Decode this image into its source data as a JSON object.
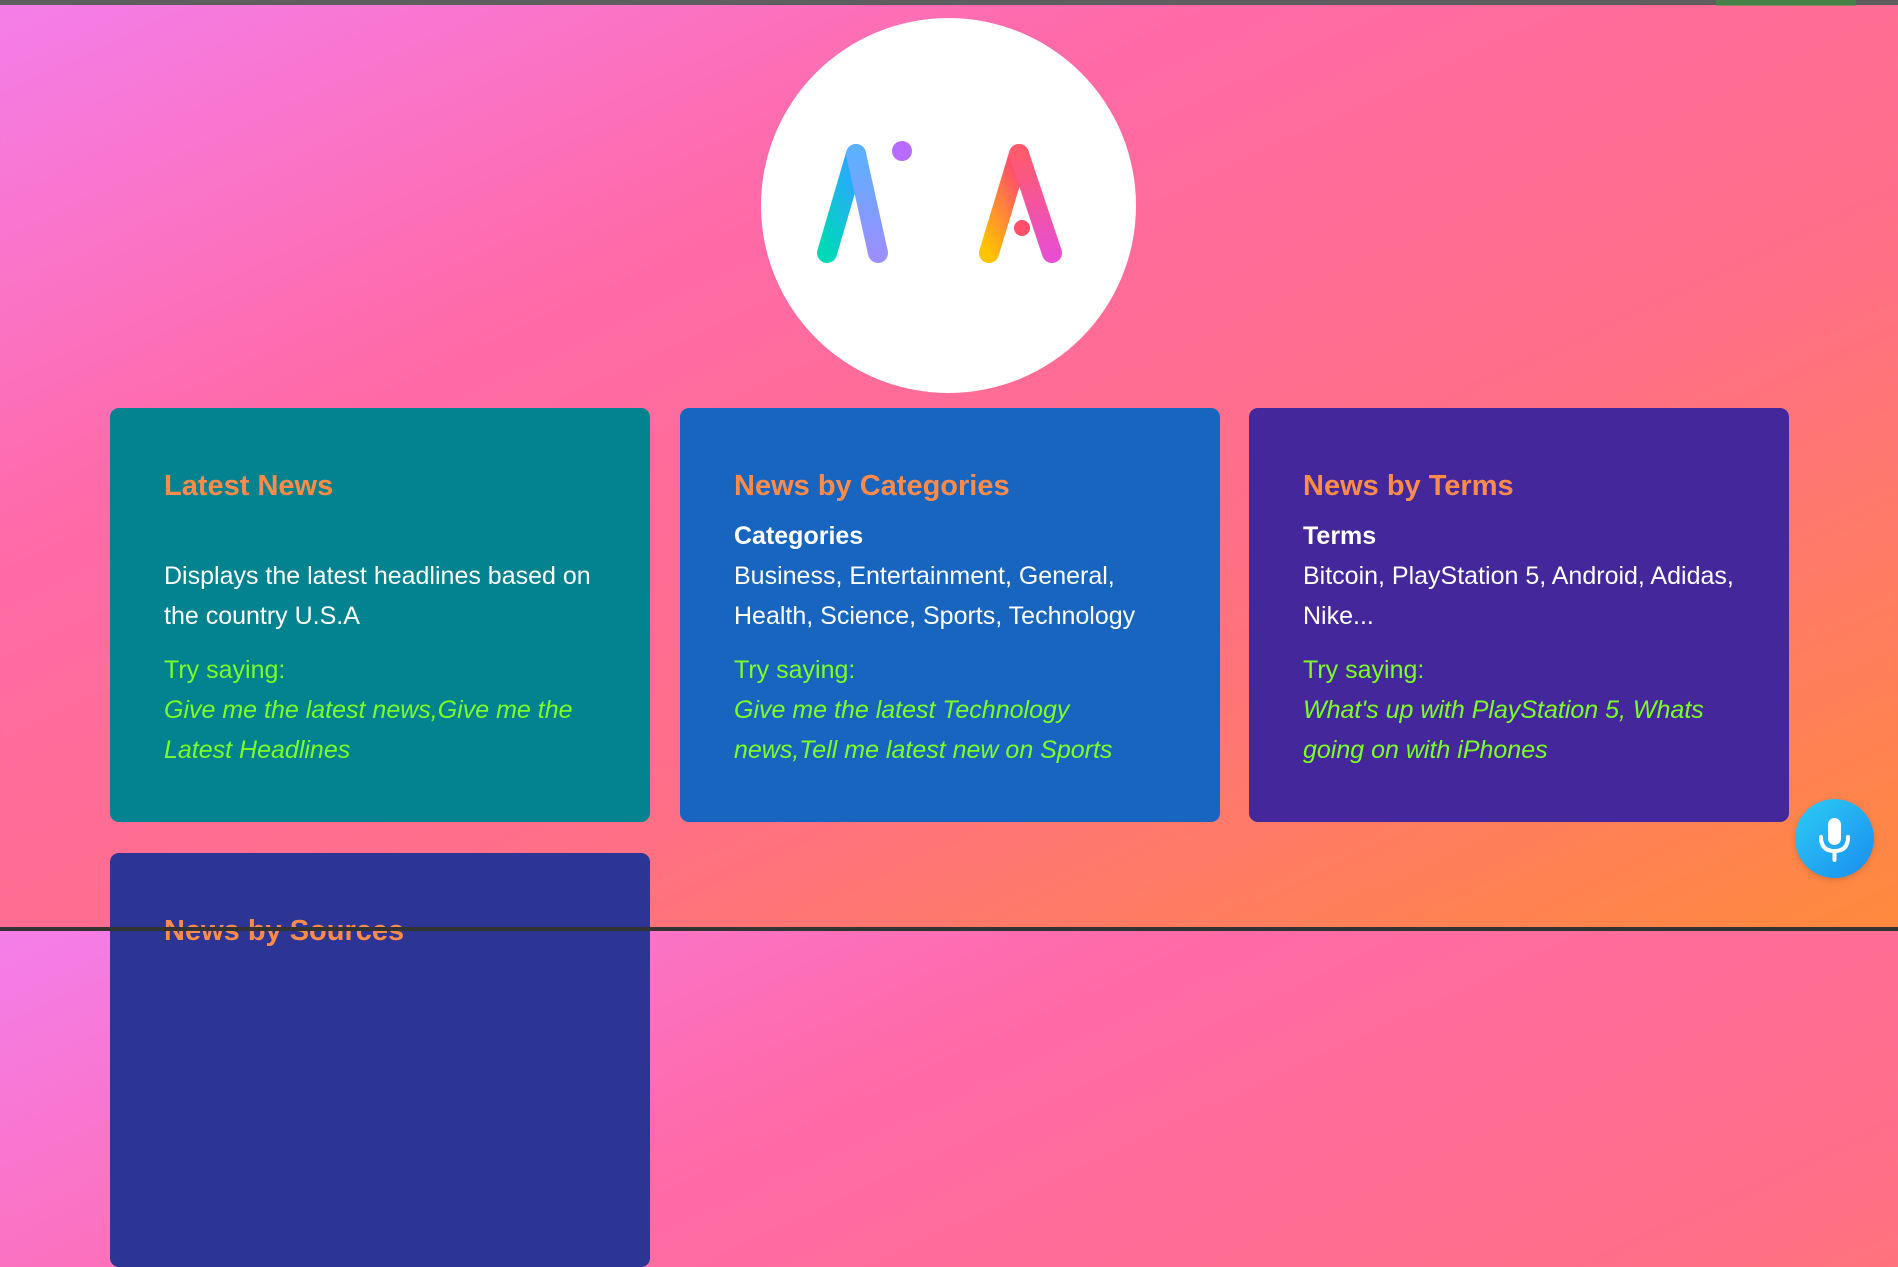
{
  "colors": {
    "card_latest": "#02838f",
    "card_categories": "#1765bf",
    "card_terms": "#44289b",
    "card_sources": "#2c3593",
    "title_orange": "#ff8b4a",
    "try_green": "#7cff24",
    "mic_blue": "#1a8cf0"
  },
  "logo": {
    "text": "Ai Al",
    "icon": "alan-ai-logo"
  },
  "cards": [
    {
      "title": "Latest News",
      "subtitle": "",
      "text": "Displays the latest headlines based on the country U.S.A",
      "try_label": "Try saying:",
      "try_examples": "Give me the latest news,Give me the Latest Headlines"
    },
    {
      "title": "News by Categories",
      "subtitle": "Categories",
      "text": "Business, Entertainment, General, Health, Science, Sports, Technology",
      "try_label": "Try saying:",
      "try_examples": "Give me the latest Technology news,Tell me latest new on Sports"
    },
    {
      "title": "News by Terms",
      "subtitle": "Terms",
      "text": "Bitcoin, PlayStation 5, Android, Adidas, Nike...",
      "try_label": "Try saying:",
      "try_examples": "What's up with PlayStation 5, Whats going on with iPhones"
    },
    {
      "title": "News by Sources"
    }
  ],
  "mic_button": {
    "icon": "microphone-icon"
  }
}
